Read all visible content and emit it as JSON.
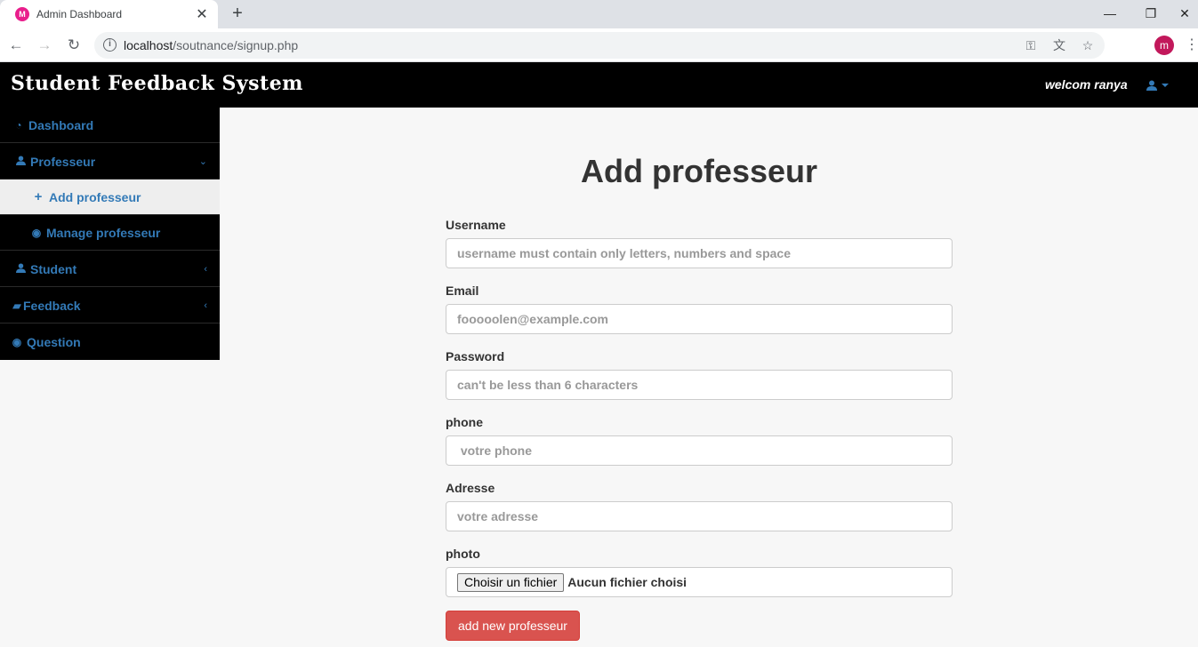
{
  "browser": {
    "tab_title": "Admin Dashboard",
    "favicon_letter": "M",
    "url_host": "localhost",
    "url_path": "/soutnance/signup.php",
    "profile_initial": "m"
  },
  "navbar": {
    "brand": "Student Feedback System",
    "welcome": "welcom ranya"
  },
  "sidebar": {
    "items": [
      {
        "label": "Dashboard",
        "icon": "dashboard-icon"
      },
      {
        "label": "Professeur",
        "icon": "user-icon"
      },
      {
        "label": "Add professeur",
        "icon": "plus-icon"
      },
      {
        "label": "Manage professeur",
        "icon": "eye-icon"
      },
      {
        "label": "Student",
        "icon": "user-icon"
      },
      {
        "label": "Feedback",
        "icon": "book-icon"
      },
      {
        "label": "Question",
        "icon": "eye-icon"
      }
    ]
  },
  "form": {
    "title": "Add professeur",
    "username": {
      "label": "Username",
      "placeholder": "username must contain only letters, numbers and space"
    },
    "email": {
      "label": "Email",
      "placeholder": "fooooolen@example.com"
    },
    "password": {
      "label": "Password",
      "placeholder": "can't be less than 6 characters"
    },
    "phone": {
      "label": "phone",
      "placeholder": " votre phone"
    },
    "adresse": {
      "label": "Adresse",
      "placeholder": "votre adresse"
    },
    "photo": {
      "label": "photo",
      "button": "Choisir un fichier",
      "status": "Aucun fichier choisi"
    },
    "submit": "add new professeur"
  },
  "colors": {
    "link_blue": "#337ab7",
    "danger": "#d9534f",
    "navbar_bg": "#000000"
  }
}
